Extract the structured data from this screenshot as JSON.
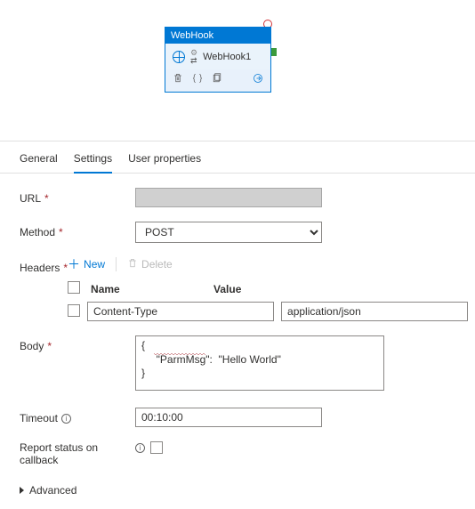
{
  "node": {
    "type_label": "WebHook",
    "name": "WebHook1"
  },
  "tabs": {
    "general": "General",
    "settings": "Settings",
    "user_properties": "User properties",
    "active": "settings"
  },
  "form": {
    "url_label": "URL",
    "method_label": "Method",
    "method_value": "POST",
    "headers_label": "Headers",
    "headers_toolbar": {
      "new": "New",
      "delete": "Delete"
    },
    "headers_columns": {
      "name": "Name",
      "value": "Value"
    },
    "headers_rows": [
      {
        "name": "Content-Type",
        "value": "application/json",
        "checked": false
      }
    ],
    "body_label": "Body",
    "body_value": "{\n     \"ParmMsg\":  \"Hello World\"\n}",
    "timeout_label": "Timeout",
    "timeout_value": "00:10:00",
    "report_label": "Report status on callback",
    "report_checked": false,
    "advanced_label": "Advanced"
  }
}
